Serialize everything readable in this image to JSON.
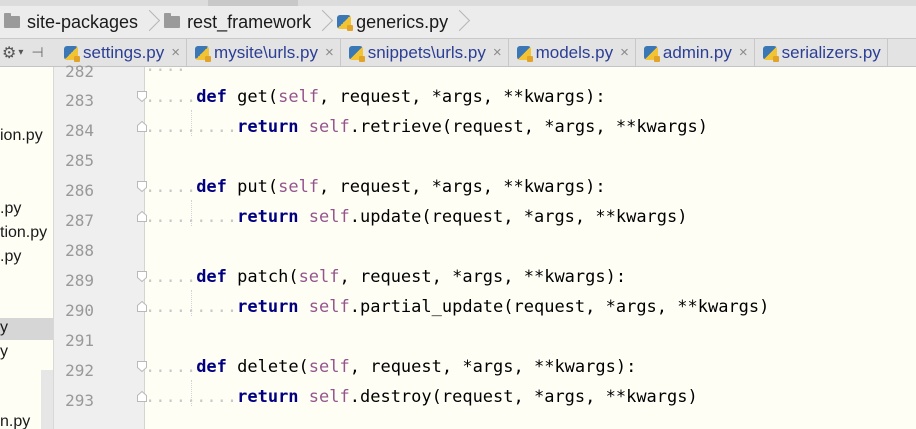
{
  "breadcrumb": {
    "items": [
      {
        "label": "site-packages",
        "icon": "folder-icon"
      },
      {
        "label": "rest_framework",
        "icon": "folder-icon"
      },
      {
        "label": "generics.py",
        "icon": "python-file-icon"
      }
    ]
  },
  "tabs": [
    {
      "label": "settings.py"
    },
    {
      "label": "mysite\\urls.py"
    },
    {
      "label": "snippets\\urls.py"
    },
    {
      "label": "models.py"
    },
    {
      "label": "admin.py"
    },
    {
      "label": "serializers.py"
    }
  ],
  "sidebar": {
    "items": [
      {
        "label": "ion.py"
      },
      {
        "label": ".py"
      },
      {
        "label": "tion.py"
      },
      {
        "label": ".py"
      },
      {
        "label": "y"
      },
      {
        "label": "y"
      },
      {
        "label": "n.py"
      }
    ]
  },
  "editor": {
    "top_partial_line": {
      "number": "282",
      "text": "\"\"\""
    },
    "lines": [
      {
        "number": "283",
        "indent": 1,
        "tokens": [
          {
            "t": "kw",
            "v": "def"
          },
          {
            "t": "tx",
            "v": " get("
          },
          {
            "t": "self",
            "v": "self"
          },
          {
            "t": "tx",
            "v": ", request, *args, **kwargs):"
          }
        ]
      },
      {
        "number": "284",
        "indent": 2,
        "tokens": [
          {
            "t": "kw",
            "v": "return"
          },
          {
            "t": "tx",
            "v": " "
          },
          {
            "t": "self",
            "v": "self"
          },
          {
            "t": "tx",
            "v": ".retrieve(request, *args, **kwargs)"
          }
        ]
      },
      {
        "number": "285",
        "indent": 0,
        "tokens": []
      },
      {
        "number": "286",
        "indent": 1,
        "tokens": [
          {
            "t": "kw",
            "v": "def"
          },
          {
            "t": "tx",
            "v": " put("
          },
          {
            "t": "self",
            "v": "self"
          },
          {
            "t": "tx",
            "v": ", request, *args, **kwargs):"
          }
        ]
      },
      {
        "number": "287",
        "indent": 2,
        "tokens": [
          {
            "t": "kw",
            "v": "return"
          },
          {
            "t": "tx",
            "v": " "
          },
          {
            "t": "self",
            "v": "self"
          },
          {
            "t": "tx",
            "v": ".update(request, *args, **kwargs)"
          }
        ]
      },
      {
        "number": "288",
        "indent": 0,
        "tokens": []
      },
      {
        "number": "289",
        "indent": 1,
        "tokens": [
          {
            "t": "kw",
            "v": "def"
          },
          {
            "t": "tx",
            "v": " patch("
          },
          {
            "t": "self",
            "v": "self"
          },
          {
            "t": "tx",
            "v": ", request, *args, **kwargs):"
          }
        ]
      },
      {
        "number": "290",
        "indent": 2,
        "tokens": [
          {
            "t": "kw",
            "v": "return"
          },
          {
            "t": "tx",
            "v": " "
          },
          {
            "t": "self",
            "v": "self"
          },
          {
            "t": "tx",
            "v": ".partial_update(request, *args, **kwargs)"
          }
        ]
      },
      {
        "number": "291",
        "indent": 0,
        "tokens": []
      },
      {
        "number": "292",
        "indent": 1,
        "tokens": [
          {
            "t": "kw",
            "v": "def"
          },
          {
            "t": "tx",
            "v": " delete("
          },
          {
            "t": "self",
            "v": "self"
          },
          {
            "t": "tx",
            "v": ", request, *args, **kwargs):"
          }
        ]
      },
      {
        "number": "293",
        "indent": 2,
        "tokens": [
          {
            "t": "kw",
            "v": "return"
          },
          {
            "t": "tx",
            "v": " "
          },
          {
            "t": "self",
            "v": "self"
          },
          {
            "t": "tx",
            "v": ".destroy(request, *args, **kwargs)"
          }
        ]
      }
    ]
  },
  "colors": {
    "keyword": "#000080",
    "self": "#94558d",
    "tab_text": "#2b3f95",
    "editor_bg": "#fffef5"
  }
}
